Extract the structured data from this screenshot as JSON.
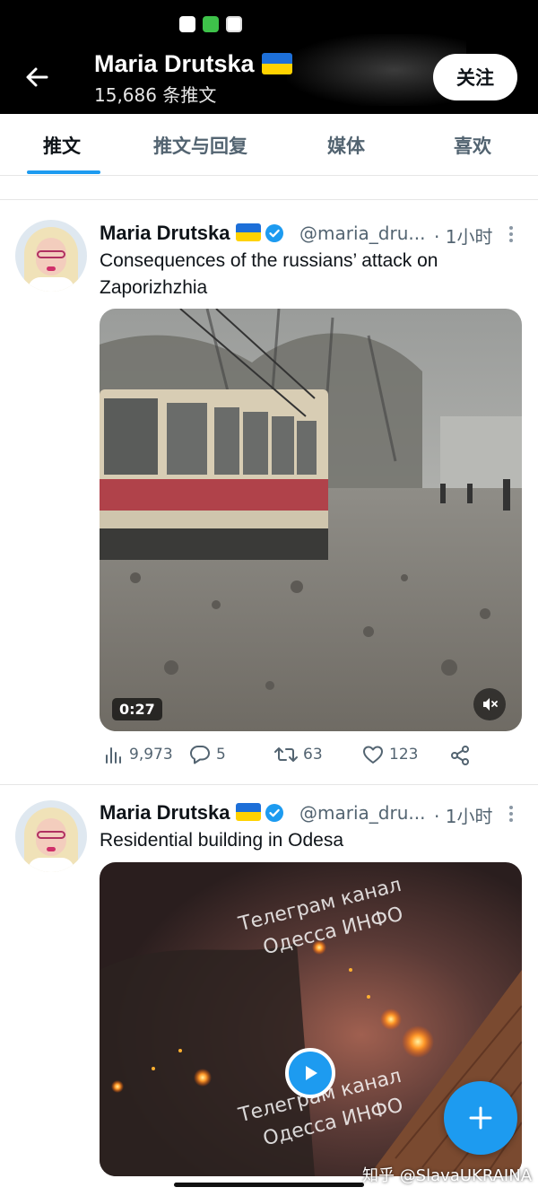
{
  "header": {
    "title": "Maria Drutska",
    "tweet_count": "15,686 条推文",
    "follow_label": "关注"
  },
  "tabs": [
    {
      "label": "推文",
      "active": true
    },
    {
      "label": "推文与回复",
      "active": false
    },
    {
      "label": "媒体",
      "active": false
    },
    {
      "label": "喜欢",
      "active": false
    }
  ],
  "tweets": [
    {
      "name": "Maria Drutska",
      "handle": "@maria_dru...",
      "time": "· 1小时",
      "text": "Consequences of the russians’ attack on Zaporizhzhia",
      "media": {
        "kind": "video",
        "duration": "0:27"
      },
      "stats": {
        "views": "9,973",
        "replies": "5",
        "retweets": "63",
        "likes": "123"
      }
    },
    {
      "name": "Maria Drutska",
      "handle": "@maria_dru...",
      "time": "· 1小时",
      "text": "Residential building in Odesa",
      "media": {
        "kind": "video",
        "watermark_line1": "Телеграм канал",
        "watermark_line2": "Одесса ИНФО"
      }
    }
  ],
  "footer": {
    "watermark": "知乎 @SlavaUKRAINA"
  },
  "colors": {
    "accent": "#1d9bf0",
    "flag_blue": "#1d6fd8",
    "flag_yellow": "#ffd200",
    "secondary_text": "#536471"
  },
  "icons": [
    "back-arrow-icon",
    "verified-badge-icon",
    "more-icon",
    "views-icon",
    "reply-icon",
    "retweet-icon",
    "like-icon",
    "share-icon",
    "mute-icon",
    "play-icon",
    "compose-plus-icon"
  ]
}
